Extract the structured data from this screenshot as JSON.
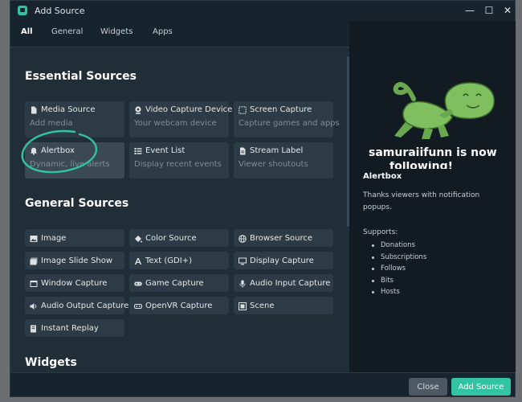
{
  "window": {
    "title": "Add Source",
    "controls": {
      "minimize": "—",
      "maximize": "☐",
      "close": "✕"
    }
  },
  "tabs": [
    {
      "label": "All",
      "active": true
    },
    {
      "label": "General"
    },
    {
      "label": "Widgets"
    },
    {
      "label": "Apps"
    }
  ],
  "sections": {
    "essential": {
      "title": "Essential Sources",
      "items": [
        {
          "title": "Media Source",
          "desc": "Add media",
          "icon": "file-icon"
        },
        {
          "title": "Video Capture Device",
          "desc": "Your webcam device",
          "icon": "webcam-icon"
        },
        {
          "title": "Screen Capture",
          "desc": "Capture games and apps",
          "icon": "screen-select-icon"
        },
        {
          "title": "Alertbox",
          "desc": "Dynamic, live alerts",
          "icon": "bell-icon",
          "selected": true
        },
        {
          "title": "Event List",
          "desc": "Display recent events",
          "icon": "list-icon"
        },
        {
          "title": "Stream Label",
          "desc": "Viewer shoutouts",
          "icon": "text-file-icon"
        }
      ]
    },
    "general": {
      "title": "General Sources",
      "items": [
        {
          "title": "Image",
          "icon": "image-icon"
        },
        {
          "title": "Color Source",
          "icon": "paint-bucket-icon"
        },
        {
          "title": "Browser Source",
          "icon": "globe-icon"
        },
        {
          "title": "Image Slide Show",
          "icon": "slideshow-icon"
        },
        {
          "title": "Text (GDI+)",
          "icon": "text-icon"
        },
        {
          "title": "Display Capture",
          "icon": "monitor-icon"
        },
        {
          "title": "Window Capture",
          "icon": "window-icon"
        },
        {
          "title": "Game Capture",
          "icon": "gamepad-icon"
        },
        {
          "title": "Audio Input Capture",
          "icon": "microphone-icon"
        },
        {
          "title": "Audio Output Capture",
          "icon": "speaker-icon"
        },
        {
          "title": "OpenVR Capture",
          "icon": "vr-headset-icon"
        },
        {
          "title": "Scene",
          "icon": "scene-icon"
        },
        {
          "title": "Instant Replay",
          "icon": "replay-icon"
        }
      ]
    },
    "widgets": {
      "title": "Widgets"
    }
  },
  "preview": {
    "image_caption_line1": "samuraiifunn is now",
    "image_caption_line2": "following!",
    "title": "Alertbox",
    "description": "Thanks viewers with notification popups.",
    "supports_label": "Supports:",
    "supports": [
      "Donations",
      "Subscriptions",
      "Follows",
      "Bits",
      "Hosts"
    ]
  },
  "footer": {
    "close_label": "Close",
    "add_label": "Add Source"
  },
  "colors": {
    "accent": "#31c3a2",
    "window_bg": "#17242d",
    "panel_bg": "#1f2e37",
    "card_bg": "#2c3b45",
    "preview_bg": "#111b21"
  }
}
